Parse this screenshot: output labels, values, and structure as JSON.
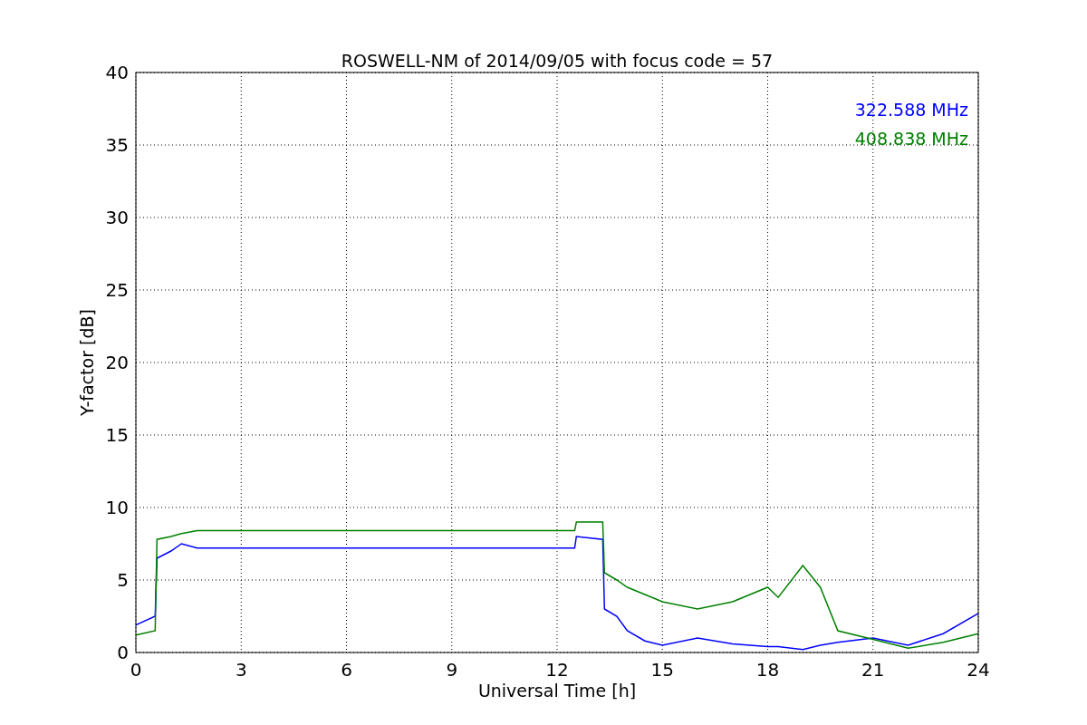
{
  "plot": {
    "chart_data": {
      "type": "line",
      "title": "ROSWELL-NM of 2014/09/05 with focus code = 57",
      "xlabel": "Universal Time [h]",
      "ylabel": "Y-factor [dB]",
      "x": [
        0,
        0.55,
        0.6,
        1,
        1.3,
        1.75,
        12.5,
        12.55,
        13.3,
        13.35,
        13.7,
        14,
        14.5,
        15,
        16,
        17,
        18,
        18.3,
        19,
        19.5,
        20,
        21,
        22,
        23,
        24
      ],
      "series": [
        {
          "name": "322.588 MHz",
          "color": "#0000ff",
          "values": [
            1.9,
            2.5,
            6.5,
            7,
            7.5,
            7.2,
            7.2,
            8,
            7.8,
            3,
            2.5,
            1.5,
            0.8,
            0.5,
            1,
            0.6,
            0.4,
            0.4,
            0.2,
            0.5,
            0.7,
            1,
            0.5,
            1.3,
            2.7
          ]
        },
        {
          "name": "408.838 MHz",
          "color": "#008000",
          "values": [
            1.2,
            1.5,
            7.8,
            8,
            8.2,
            8.4,
            8.4,
            9,
            9,
            5.5,
            5,
            4.5,
            4,
            3.5,
            3,
            3.5,
            4.5,
            3.8,
            6,
            4.5,
            1.5,
            0.9,
            0.3,
            0.7,
            1.3
          ]
        }
      ],
      "xlim": [
        0,
        24
      ],
      "ylim": [
        0,
        40
      ],
      "xticks": [
        0,
        3,
        6,
        9,
        12,
        15,
        18,
        21,
        24
      ],
      "yticks": [
        0,
        5,
        10,
        15,
        20,
        25,
        30,
        35,
        40
      ],
      "grid": true
    }
  }
}
